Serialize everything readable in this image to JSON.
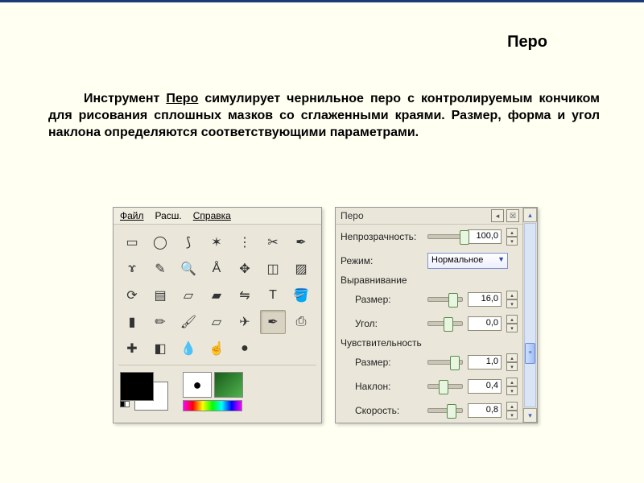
{
  "page": {
    "title": "Перо",
    "description_prefix": "Инструмент ",
    "description_tool": "Перо",
    "description_rest": " симулирует чернильное перо с контролируемым кончиком для рисования сплошных мазков со сглаженными краями. Размер, форма и угол наклона определяются соответствующими параметрами."
  },
  "toolbox": {
    "menu": {
      "file": "Файл",
      "ext": "Расш.",
      "help": "Справка"
    },
    "tools": [
      {
        "name": "rect-select",
        "glyph": "▭"
      },
      {
        "name": "ellipse-select",
        "glyph": "◯"
      },
      {
        "name": "free-select",
        "glyph": "⟆"
      },
      {
        "name": "fuzzy-select",
        "glyph": "✶"
      },
      {
        "name": "color-select",
        "glyph": "⋮"
      },
      {
        "name": "scissors",
        "glyph": "✂"
      },
      {
        "name": "foreground-select",
        "glyph": "✒"
      },
      {
        "name": "paths",
        "glyph": "ɤ"
      },
      {
        "name": "color-picker",
        "glyph": "✎"
      },
      {
        "name": "zoom",
        "glyph": "🔍"
      },
      {
        "name": "measure",
        "glyph": "Å"
      },
      {
        "name": "move",
        "glyph": "✥"
      },
      {
        "name": "align",
        "glyph": "◫"
      },
      {
        "name": "crop",
        "glyph": "▨"
      },
      {
        "name": "rotate",
        "glyph": "⟳"
      },
      {
        "name": "scale",
        "glyph": "▤"
      },
      {
        "name": "shear",
        "glyph": "▱"
      },
      {
        "name": "perspective",
        "glyph": "▰"
      },
      {
        "name": "flip",
        "glyph": "⇋"
      },
      {
        "name": "text",
        "glyph": "T"
      },
      {
        "name": "bucket-fill",
        "glyph": "🪣"
      },
      {
        "name": "gradient",
        "glyph": "▮"
      },
      {
        "name": "pencil",
        "glyph": "✏"
      },
      {
        "name": "paintbrush",
        "glyph": "🖌"
      },
      {
        "name": "eraser",
        "glyph": "▱"
      },
      {
        "name": "airbrush",
        "glyph": "✈"
      },
      {
        "name": "ink",
        "glyph": "✒",
        "selected": true
      },
      {
        "name": "clone",
        "glyph": "⎙"
      },
      {
        "name": "heal",
        "glyph": "✚"
      },
      {
        "name": "perspective-clone",
        "glyph": "◧"
      },
      {
        "name": "blur",
        "glyph": "💧"
      },
      {
        "name": "smudge",
        "glyph": "☝"
      },
      {
        "name": "dodge-burn",
        "glyph": "●"
      }
    ],
    "fg_color": "#000000",
    "bg_color": "#ffffff"
  },
  "options": {
    "title": "Перо",
    "opacity": {
      "label": "Непрозрачность:",
      "value": "100,0",
      "pos": 92
    },
    "mode": {
      "label": "Режим:",
      "value": "Нормальное"
    },
    "alignment": {
      "title": "Выравнивание",
      "size": {
        "label": "Размер:",
        "value": "16,0",
        "pos": 60
      },
      "angle": {
        "label": "Угол:",
        "value": "0,0",
        "pos": 45
      }
    },
    "sensitivity": {
      "title": "Чувствительность",
      "size": {
        "label": "Размер:",
        "value": "1,0",
        "pos": 65
      },
      "tilt": {
        "label": "Наклон:",
        "value": "0,4",
        "pos": 30
      },
      "speed": {
        "label": "Скорость:",
        "value": "0,8",
        "pos": 55
      }
    }
  }
}
